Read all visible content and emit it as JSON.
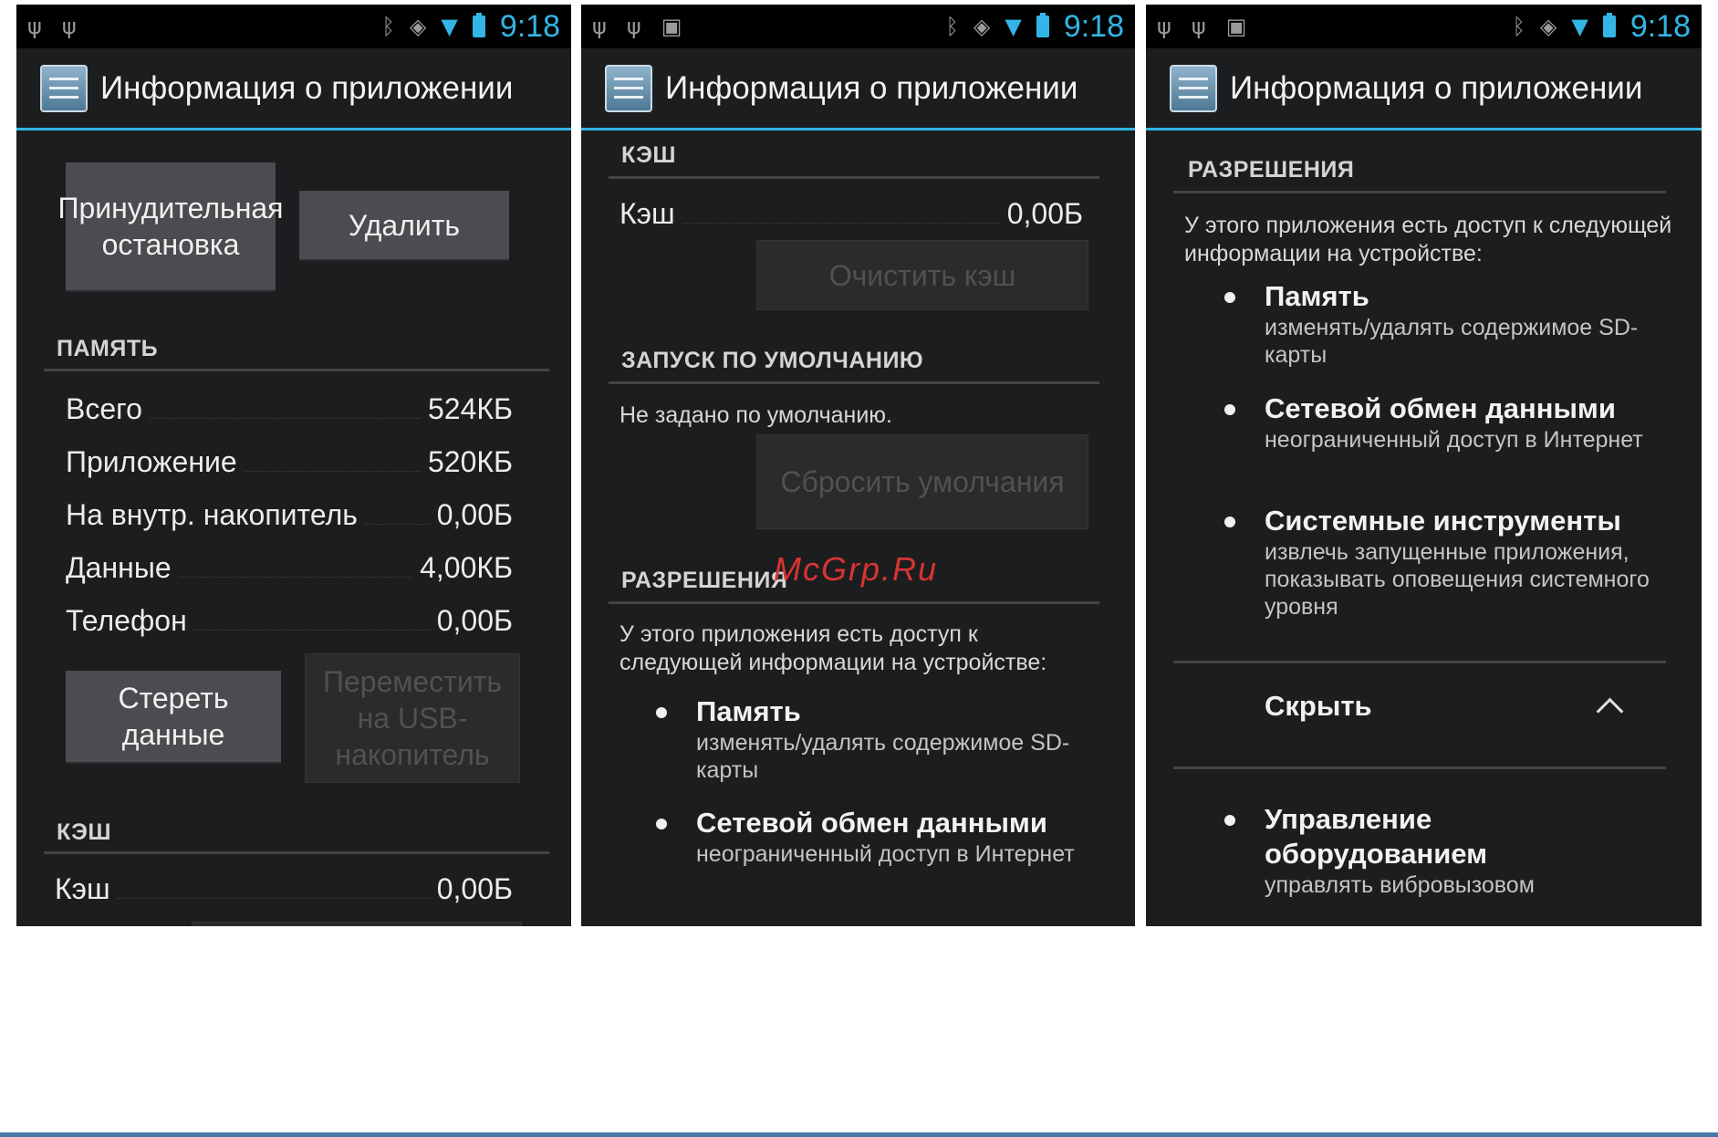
{
  "status_bar": {
    "time": "9:18"
  },
  "app_title": "Информация о приложении",
  "screen1": {
    "force_stop": "Принудительная остановка",
    "delete": "Удалить",
    "memory_header": "ПАМЯТЬ",
    "memory_rows": [
      {
        "label": "Всего",
        "value": "524КБ"
      },
      {
        "label": "Приложение",
        "value": "520КБ"
      },
      {
        "label": "На внутр. накопитель",
        "value": "0,00Б"
      },
      {
        "label": "Данные",
        "value": "4,00КБ"
      },
      {
        "label": "Телефон",
        "value": "0,00Б"
      }
    ],
    "clear_data": "Стереть данные",
    "move_usb": "Переместить на USB-накопитель",
    "cache_header": "КЭШ",
    "cache_label": "Кэш",
    "cache_value": "0,00Б"
  },
  "screen2": {
    "cache_header": "КЭШ",
    "cache_label": "Кэш",
    "cache_value": "0,00Б",
    "clear_cache": "Очистить кэш",
    "launch_header": "ЗАПУСК ПО УМОЛЧАНИЮ",
    "not_set": "Не задано по умолчанию.",
    "reset_defaults": "Сбросить умолчания",
    "perm_header": "РАЗРЕШЕНИЯ",
    "perm_intro": "У этого приложения есть доступ к следующей информации на устройстве:",
    "perms": [
      {
        "title": "Память",
        "desc": "изменять/удалять содержимое SD-карты"
      },
      {
        "title": "Сетевой обмен данными",
        "desc": "неограниченный доступ в Интернет"
      }
    ]
  },
  "screen3": {
    "perm_header": "РАЗРЕШЕНИЯ",
    "perm_intro": "У этого приложения есть доступ к следующей информации на устройстве:",
    "perms": [
      {
        "title": "Память",
        "desc": "изменять/удалять содержимое SD-карты"
      },
      {
        "title": "Сетевой обмен данными",
        "desc": "неограниченный доступ в Интернет"
      },
      {
        "title": "Системные инструменты",
        "desc": "извлечь запущенные приложения, показывать оповещения системного уровня"
      }
    ],
    "hide_label": "Скрыть",
    "extra_perm": {
      "title": "Управление оборудованием",
      "desc": "управлять вибровызовом"
    }
  },
  "watermark": "McGrp.Ru",
  "colors": {
    "accent": "#33b5e5",
    "background": "#1c1d1f",
    "button": "#4a4c4f"
  }
}
